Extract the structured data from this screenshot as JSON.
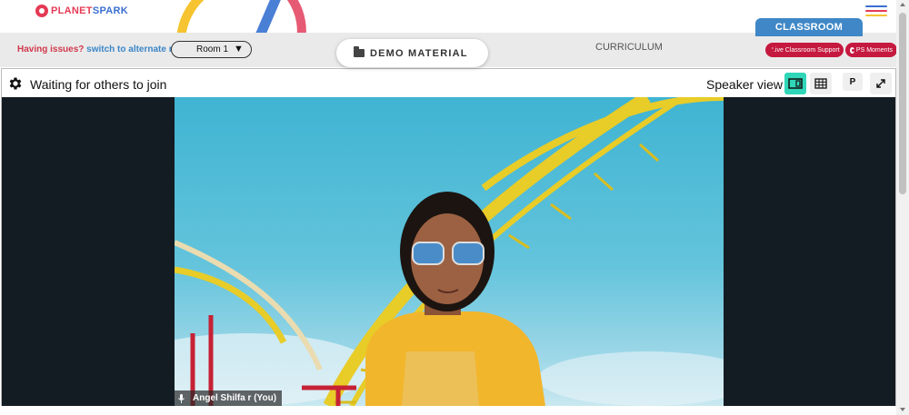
{
  "header": {
    "logo_text_a": "PLANET",
    "logo_text_b": "SPARK",
    "classroom_tab": "CLASSROOM",
    "menu_icon": "hamburger-icon"
  },
  "toolbar": {
    "issue_question": "Having issues?",
    "issue_switch": "switch to alternate room",
    "room_value": "Room 1",
    "room_arrow": "▼",
    "demo_label": "DEMO MATERIAL",
    "demo_icon": "folder-icon",
    "curriculum": "CURRICULUM",
    "support_label": "Live Classroom Support",
    "moments_label": "PS Moments"
  },
  "meeting": {
    "status_text": "Waiting for others to join",
    "view_label": "Speaker view",
    "p_button": "P",
    "participant_name": "Angel Shilfa r (You)"
  },
  "colors": {
    "brand_red": "#e53a55",
    "brand_blue": "#3a6fd1",
    "pill_red": "#c5193f",
    "classroom_blue": "#3f87c7",
    "speaker_active": "#2fd6b8",
    "video_bg": "#141c23"
  }
}
